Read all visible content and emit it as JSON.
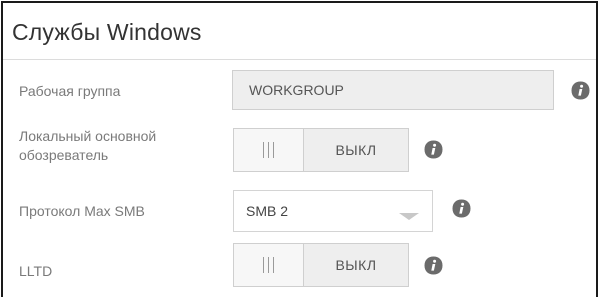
{
  "panel": {
    "title": "Службы Windows"
  },
  "workgroup": {
    "label": "Рабочая группа",
    "value": "WORKGROUP",
    "info_icon": "info-icon"
  },
  "local_master_browser": {
    "label_line1": "Локальный основной",
    "label_line2": "обозреватель",
    "state": "ВЫКЛ",
    "enabled": false,
    "info_icon": "info-icon"
  },
  "max_smb": {
    "label": "Протокол Max SMB",
    "selected": "SMB 2",
    "info_icon": "info-icon"
  },
  "lltd": {
    "label": "LLTD",
    "state": "ВЫКЛ",
    "enabled": false,
    "info_icon": "info-icon"
  },
  "colors": {
    "info_icon_fill": "#6b6b6b",
    "control_fill": "#eeeeee",
    "border": "#cfcfcf",
    "label_text": "#7a7a7a"
  }
}
